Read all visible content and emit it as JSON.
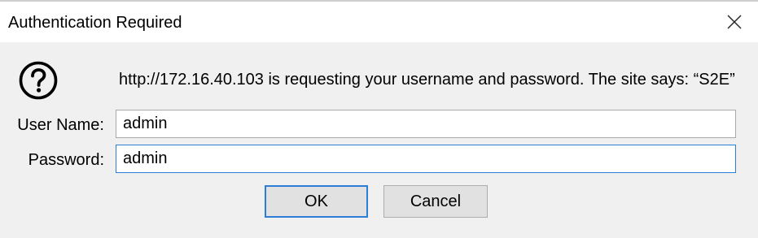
{
  "dialog": {
    "title": "Authentication Required",
    "message": "http://172.16.40.103 is requesting your username and password. The site says: “S2E”",
    "username": {
      "label": "User Name:",
      "value": "admin"
    },
    "password": {
      "label": "Password:",
      "value": "admin"
    },
    "buttons": {
      "ok": "OK",
      "cancel": "Cancel"
    },
    "icons": {
      "prompt": "question-icon",
      "close": "close-icon"
    },
    "colors": {
      "focus_border": "#2b7dd6",
      "dialog_background": "#f0f0f0",
      "titlebar_background": "#ffffff"
    }
  }
}
